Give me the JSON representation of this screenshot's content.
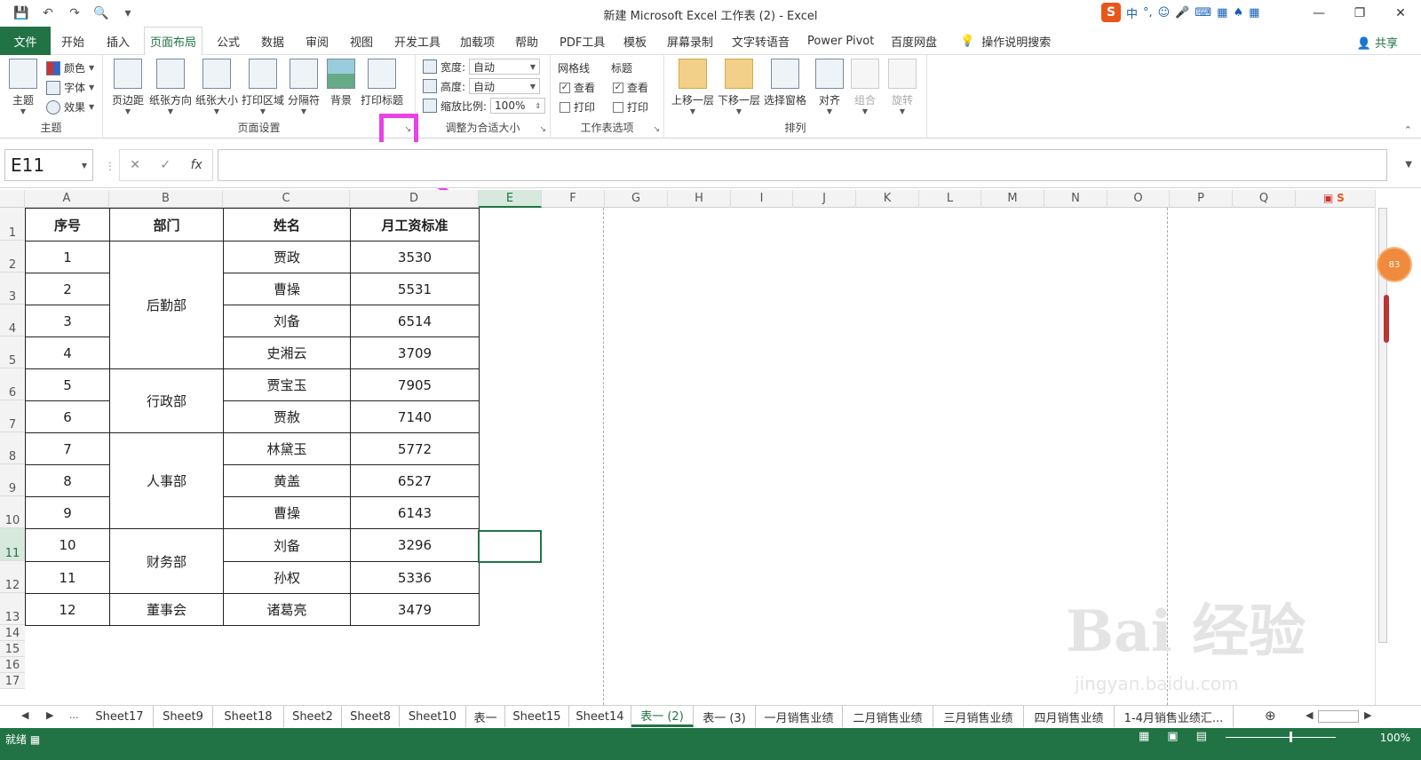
{
  "window": {
    "title": "新建 Microsoft Excel 工作表 (2)  -  Excel"
  },
  "ime": {
    "logo": "S",
    "mode": "中"
  },
  "file_tab": "文件",
  "tabs": [
    "开始",
    "插入",
    "页面布局",
    "公式",
    "数据",
    "审阅",
    "视图",
    "开发工具",
    "加载项",
    "帮助",
    "PDF工具",
    "模板",
    "屏幕录制",
    "文字转语音",
    "Power Pivot",
    "百度网盘"
  ],
  "active_tab": "页面布局",
  "tell_me": "操作说明搜索",
  "share": "共享",
  "ribbon": {
    "themes": {
      "label": "主题",
      "theme_btn": "主题",
      "colors": "颜色",
      "fonts": "字体",
      "effects": "效果"
    },
    "page_setup": {
      "label": "页面设置",
      "margins": "页边距",
      "orientation": "纸张方向",
      "size": "纸张大小",
      "print_area": "打印区域",
      "breaks": "分隔符",
      "background": "背景",
      "print_titles": "打印标题"
    },
    "scale": {
      "label": "调整为合适大小",
      "width_label": "宽度:",
      "width_value": "自动",
      "height_label": "高度:",
      "height_value": "自动",
      "scale_label": "缩放比例:",
      "scale_value": "100%"
    },
    "sheet_options": {
      "label": "工作表选项",
      "gridlines": "网格线",
      "headings": "标题",
      "view": "查看",
      "print": "打印",
      "grid_view": true,
      "grid_print": false,
      "head_view": true,
      "head_print": false
    },
    "arrange": {
      "label": "排列",
      "bring_forward": "上移一层",
      "send_backward": "下移一层",
      "selection_pane": "选择窗格",
      "align": "对齐",
      "group": "组合",
      "rotate": "旋转"
    }
  },
  "namebox": "E11",
  "formula": "",
  "columns": [
    "A",
    "B",
    "C",
    "D",
    "E",
    "F",
    "G",
    "H",
    "I",
    "J",
    "K",
    "L",
    "M",
    "N",
    "O",
    "P",
    "Q"
  ],
  "selected_column": "E",
  "rows": [
    "1",
    "2",
    "3",
    "4",
    "5",
    "6",
    "7",
    "8",
    "9",
    "10",
    "11",
    "12",
    "13",
    "14",
    "15",
    "16",
    "17"
  ],
  "selected_row": "11",
  "table": {
    "headers": [
      "序号",
      "部门",
      "姓名",
      "月工资标准"
    ],
    "rows": [
      {
        "no": "1",
        "name": "贾政",
        "salary": "3530"
      },
      {
        "no": "2",
        "name": "曹操",
        "salary": "5531"
      },
      {
        "no": "3",
        "name": "刘备",
        "salary": "6514"
      },
      {
        "no": "4",
        "name": "史湘云",
        "salary": "3709"
      },
      {
        "no": "5",
        "name": "贾宝玉",
        "salary": "7905"
      },
      {
        "no": "6",
        "name": "贾赦",
        "salary": "7140"
      },
      {
        "no": "7",
        "name": "林黛玉",
        "salary": "5772"
      },
      {
        "no": "8",
        "name": "黄盖",
        "salary": "6527"
      },
      {
        "no": "9",
        "name": "曹操",
        "salary": "6143"
      },
      {
        "no": "10",
        "name": "刘备",
        "salary": "3296"
      },
      {
        "no": "11",
        "name": "孙权",
        "salary": "5336"
      },
      {
        "no": "12",
        "name": "诸葛亮",
        "salary": "3479"
      }
    ],
    "departments": [
      "后勤部",
      "行政部",
      "人事部",
      "财务部",
      "董事会"
    ]
  },
  "sheets": [
    "Sheet17",
    "Sheet9",
    "Sheet18",
    "Sheet2",
    "Sheet8",
    "Sheet10",
    "表一",
    "Sheet15",
    "Sheet14",
    "表一 (2)",
    "表一 (3)",
    "一月销售业绩",
    "二月销售业绩",
    "三月销售业绩",
    "四月销售业绩",
    "1-4月销售业绩汇..."
  ],
  "active_sheet": "表一 (2)",
  "status": {
    "ready": "就绪",
    "zoom": "100%"
  },
  "float_badge": "83",
  "watermark": {
    "main": "Bai 经验",
    "sub": "jingyan.baidu.com"
  },
  "colors": {
    "excel_green": "#217346",
    "highlight": "#e842e8",
    "ime_orange": "#e8561a"
  }
}
